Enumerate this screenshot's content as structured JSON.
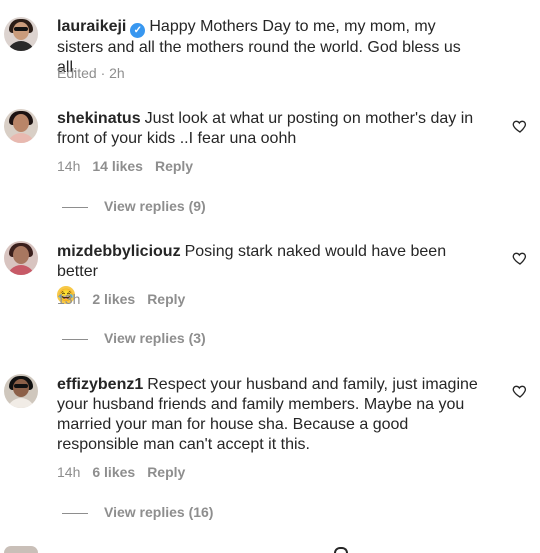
{
  "caption": {
    "username": "lauraikeji",
    "text": "Happy Mothers Day to me, my mom, my sisters and all the mothers round the world. God bless us all.",
    "meta": "Edited · 2h"
  },
  "comments": [
    {
      "username": "shekinatus",
      "text": "Just look at what ur posting on mother's day in front of your kids ..I fear una oohh",
      "time": "14h",
      "likes": "14 likes",
      "reply": "Reply",
      "view_replies": "View replies (9)"
    },
    {
      "username": "mizdebbyliciouz",
      "text": "Posing stark naked would have been better",
      "emoji": "😂",
      "time": "13h",
      "likes": "2 likes",
      "reply": "Reply",
      "view_replies": "View replies (3)"
    },
    {
      "username": "effizybenz1",
      "text": "Respect your husband and family, just imagine your husband friends and family members. Maybe na you married your man for house sha. Because a good responsible man can't accept it this.",
      "time": "14h",
      "likes": "6 likes",
      "reply": "Reply",
      "view_replies": "View replies (16)"
    }
  ],
  "icons": {
    "heart": "heart-outline-icon",
    "verified": "verified-badge-icon"
  },
  "colors": {
    "text": "#262626",
    "secondary": "#8e8e8e",
    "verified": "#3897f0"
  }
}
